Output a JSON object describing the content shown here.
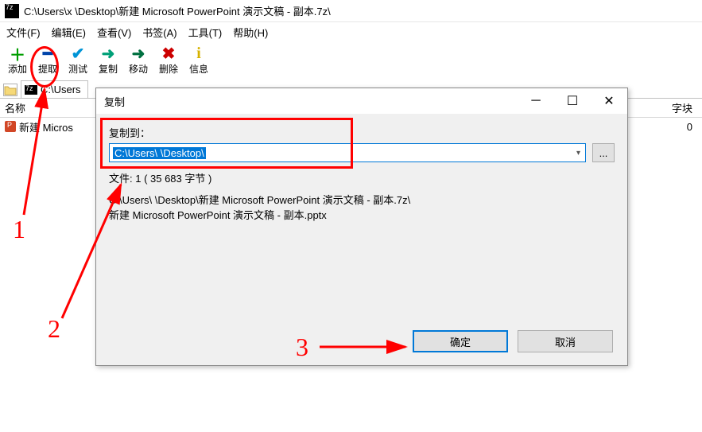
{
  "title_path": "C:\\Users\\x           \\Desktop\\新建 Microsoft PowerPoint 演示文稿 - 副本.7z\\",
  "menu": {
    "file": "文件(F)",
    "edit": "编辑(E)",
    "view": "查看(V)",
    "bookmark": "书签(A)",
    "tool": "工具(T)",
    "help": "帮助(H)"
  },
  "toolbar": {
    "add": {
      "label": "添加",
      "glyph": "＋",
      "color": "#009e00"
    },
    "extract": {
      "label": "提取",
      "glyph": "➥",
      "color": "#0066d6"
    },
    "test": {
      "label": "测试",
      "glyph": "✔",
      "color": "#0094d6"
    },
    "copy": {
      "label": "复制",
      "glyph": "➜",
      "color": "#00a078"
    },
    "move": {
      "label": "移动",
      "glyph": "➜",
      "color": "#007040"
    },
    "delete": {
      "label": "删除",
      "glyph": "✖",
      "color": "#cc0000"
    },
    "info": {
      "label": "信息",
      "glyph": "i",
      "color": "#d6b200"
    }
  },
  "tab_label": "C:\\Users",
  "columns": {
    "name": "名称",
    "size": "字块"
  },
  "row1": {
    "name": "新建 Micros",
    "size": "0"
  },
  "dialog": {
    "title": "复制",
    "dest_label": "复制到：",
    "dest_prefix": "C:\\Users\\",
    "dest_selected": "            ",
    "dest_suffix": "\\Desktop\\",
    "browse": "...",
    "files_line": "文件: 1    ( 35 683 字节 )",
    "src1": "C:\\Users\\             \\Desktop\\新建 Microsoft PowerPoint 演示文稿 - 副本.7z\\",
    "src2": "新建 Microsoft PowerPoint 演示文稿 - 副本.pptx",
    "ok": "确定",
    "cancel": "取消"
  },
  "anno": {
    "n1": "1",
    "n2": "2",
    "n3": "3"
  }
}
